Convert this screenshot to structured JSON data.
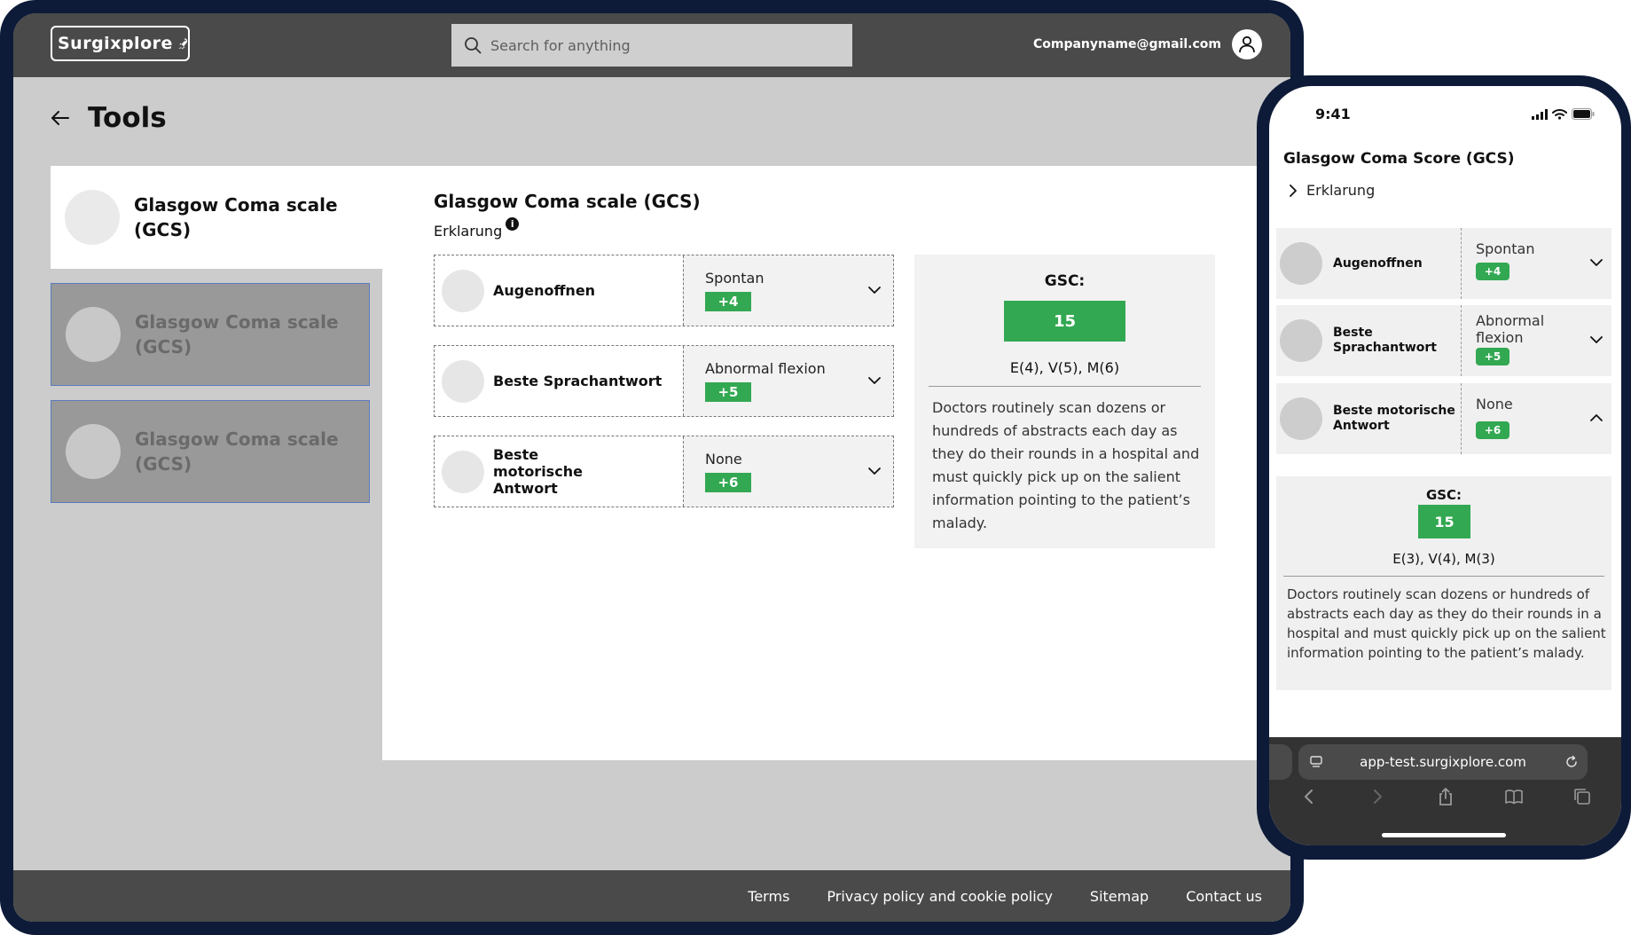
{
  "desktop": {
    "logo_text": "Surgixplore",
    "search_placeholder": "Search for anything",
    "user_email": "Companyname@gmail.com",
    "page_title": "Tools",
    "tool_list": [
      {
        "name": "Glasgow Coma scale (GCS)",
        "state": "active"
      },
      {
        "name": "Glasgow Coma scale (GCS)",
        "state": "inactive"
      },
      {
        "name": "Glasgow Coma scale (GCS)",
        "state": "inactive"
      }
    ],
    "calculator": {
      "title": "Glasgow Coma scale (GCS)",
      "erklarung": "Erklarung",
      "info_icon_glyph": "i",
      "criteria": [
        {
          "label": "Augenoffnen",
          "value": "Spontan",
          "score": "+4"
        },
        {
          "label": "Beste Sprachantwort",
          "value": "Abnormal flexion",
          "score": "+5"
        },
        {
          "label": "Beste motorische Antwort",
          "value": "None",
          "score": "+6"
        }
      ],
      "result": {
        "label": "GSC:",
        "score": "15",
        "breakdown": "E(4), V(5), M(6)",
        "description": "Doctors routinely scan dozens or hundreds of abstracts each day as they do their rounds in a hospital and must quickly pick up on the salient information pointing to the patient’s malady."
      }
    },
    "footer_links": [
      "Terms",
      "Privacy policy and cookie policy",
      "Sitemap",
      "Contact us"
    ]
  },
  "mobile": {
    "status_time": "9:41",
    "title": "Glasgow Coma Score (GCS)",
    "erklarung": "Erklarung",
    "criteria": [
      {
        "label": "Augenoffnen",
        "value": "Spontan",
        "score": "+4",
        "chevron": "chevron-down-icon"
      },
      {
        "label": "Beste Sprachantwort",
        "value": "Abnormal flexion",
        "score": "+5",
        "chevron": "chevron-down-icon"
      },
      {
        "label": "Beste motorische Antwort",
        "value": "None",
        "score": "+6",
        "chevron": "chevron-up-icon"
      }
    ],
    "result": {
      "label": "GSC:",
      "score": "15",
      "breakdown": "E(3), V(4), M(3)",
      "description": "Doctors routinely scan dozens or hundreds of abstracts each day as they do their rounds in a hospital and must quickly pick up on the salient information pointing to the patient’s malady."
    },
    "browser_url": "app-test.surgixplore.com"
  },
  "colors": {
    "frame": "#0d1b38",
    "topbar": "#4a4a4a",
    "badge_green": "#33a852",
    "inactive_card": "#999999",
    "inactive_card_border": "#5b7bbf"
  }
}
